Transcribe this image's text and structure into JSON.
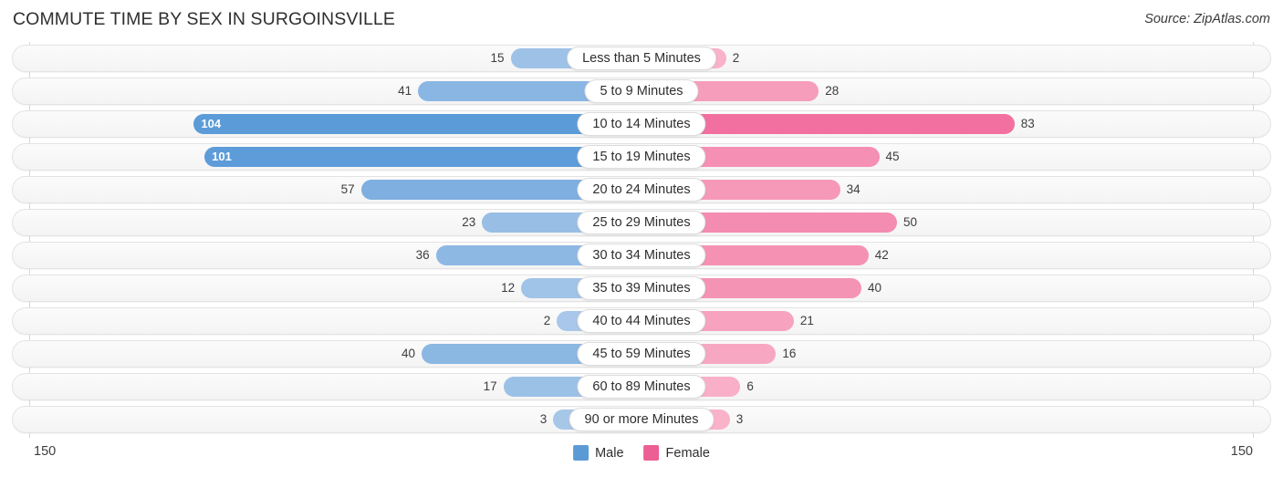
{
  "title": "COMMUTE TIME BY SEX IN SURGOINSVILLE",
  "source": "Source: ZipAtlas.com",
  "axis": {
    "left_max": "150",
    "right_max": "150"
  },
  "legend": {
    "male": {
      "label": "Male",
      "color": "#5b9bd5"
    },
    "female": {
      "label": "Female",
      "color": "#ec5f94"
    }
  },
  "colors": {
    "male_dark": "#5b9bd8",
    "male_light": "#a9c8ea",
    "female_dark": "#ef5f94",
    "female_light": "#f9b4ca",
    "track": "#f6f6f6",
    "axis": "#d8d8d8"
  },
  "chart_data": {
    "type": "bar",
    "title": "COMMUTE TIME BY SEX IN SURGOINSVILLE",
    "subtitle": "Source: ZipAtlas.com",
    "orientation": "horizontal-diverging",
    "xlabel": "",
    "ylabel": "",
    "xlim": [
      -150,
      150
    ],
    "axis_max": 150,
    "grid": false,
    "legend_position": "bottom-center",
    "categories": [
      "Less than 5 Minutes",
      "5 to 9 Minutes",
      "10 to 14 Minutes",
      "15 to 19 Minutes",
      "20 to 24 Minutes",
      "25 to 29 Minutes",
      "30 to 34 Minutes",
      "35 to 39 Minutes",
      "40 to 44 Minutes",
      "45 to 59 Minutes",
      "60 to 89 Minutes",
      "90 or more Minutes"
    ],
    "series": [
      {
        "name": "Male",
        "values": [
          15,
          41,
          104,
          101,
          57,
          23,
          36,
          12,
          2,
          40,
          17,
          3
        ]
      },
      {
        "name": "Female",
        "values": [
          2,
          28,
          83,
          45,
          34,
          50,
          42,
          40,
          21,
          16,
          6,
          3
        ]
      }
    ]
  },
  "rows": [
    {
      "category": "Less than 5 Minutes",
      "male": "15",
      "female": "2"
    },
    {
      "category": "5 to 9 Minutes",
      "male": "41",
      "female": "28"
    },
    {
      "category": "10 to 14 Minutes",
      "male": "104",
      "female": "83"
    },
    {
      "category": "15 to 19 Minutes",
      "male": "101",
      "female": "45"
    },
    {
      "category": "20 to 24 Minutes",
      "male": "57",
      "female": "34"
    },
    {
      "category": "25 to 29 Minutes",
      "male": "23",
      "female": "50"
    },
    {
      "category": "30 to 34 Minutes",
      "male": "36",
      "female": "42"
    },
    {
      "category": "35 to 39 Minutes",
      "male": "12",
      "female": "40"
    },
    {
      "category": "40 to 44 Minutes",
      "male": "2",
      "female": "21"
    },
    {
      "category": "45 to 59 Minutes",
      "male": "40",
      "female": "16"
    },
    {
      "category": "60 to 89 Minutes",
      "male": "17",
      "female": "6"
    },
    {
      "category": "90 or more Minutes",
      "male": "3",
      "female": "3"
    }
  ]
}
